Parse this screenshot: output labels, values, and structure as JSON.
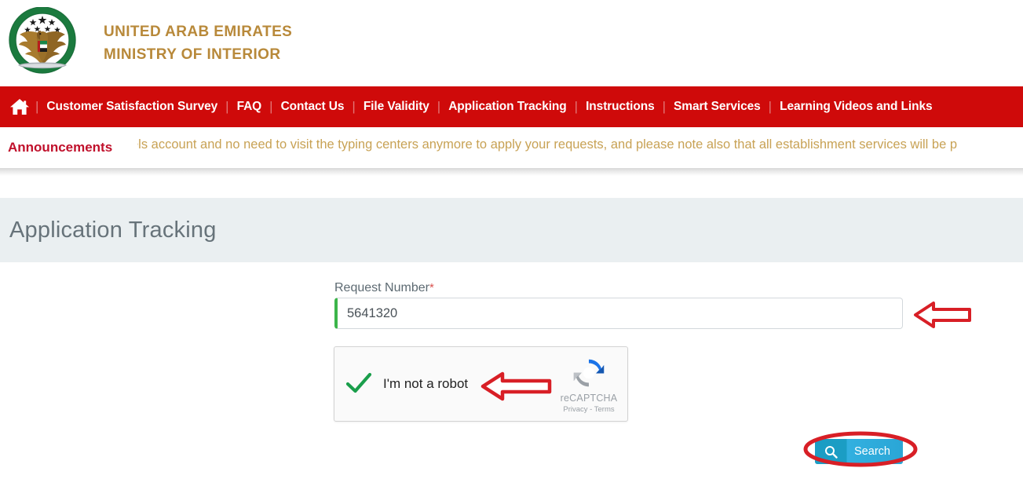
{
  "header": {
    "org_line1": "UNITED ARAB EMIRATES",
    "org_line2": "MINISTRY OF INTERIOR",
    "emblem_name": "uae-moi-emblem",
    "gold_color": "#b8893a"
  },
  "nav": {
    "home_icon": "home-icon",
    "background_color": "#cf0a0a",
    "separator": "|",
    "items": [
      {
        "label": "Customer Satisfaction Survey"
      },
      {
        "label": "FAQ"
      },
      {
        "label": "Contact Us"
      },
      {
        "label": "File Validity"
      },
      {
        "label": "Application Tracking"
      },
      {
        "label": "Instructions"
      },
      {
        "label": "Smart Services"
      },
      {
        "label": "Learning Videos and Links"
      }
    ]
  },
  "announcements": {
    "label": "Announcements",
    "label_color": "#c0102b",
    "text_color": "#c8a255",
    "ticker_text": "els account and no need to visit the typing centers anymore to apply your requests, and please note also that all establishment services will be p"
  },
  "page": {
    "title": "Application Tracking",
    "band_color": "#eaeff1",
    "title_color": "#67737a"
  },
  "form": {
    "request_number": {
      "label": "Request Number",
      "required_marker": "*",
      "value": "5641320",
      "placeholder": "",
      "valid_accent_color": "#3cb54a"
    },
    "recaptcha": {
      "checkbox_state": "checked",
      "check_icon": "green-checkmark-icon",
      "label": "I'm not a robot",
      "logo_icon": "recaptcha-logo-icon",
      "brand": "reCAPTCHA",
      "terms": "Privacy - Terms"
    },
    "search_button": {
      "label": "Search",
      "icon": "magnifier-icon",
      "color": "#2aa6d6"
    }
  },
  "annotations": {
    "color": "#d81f26",
    "items": [
      {
        "type": "arrow-left",
        "target": "request-number-input"
      },
      {
        "type": "arrow-left",
        "target": "recaptcha-checkbox"
      },
      {
        "type": "ellipse",
        "target": "search-button"
      }
    ]
  }
}
